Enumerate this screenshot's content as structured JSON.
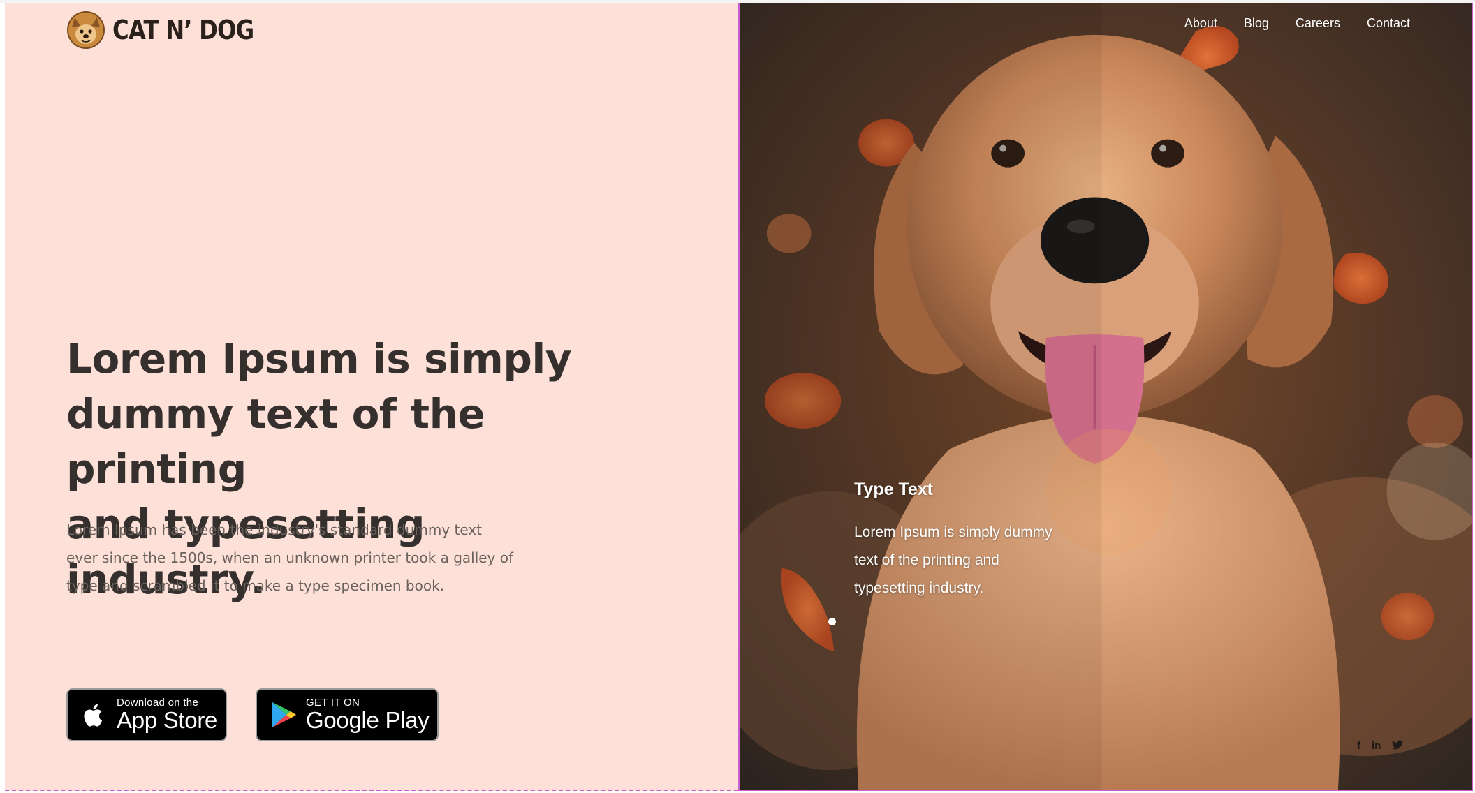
{
  "brand": {
    "name": "CAT N’ DOG",
    "logo_icon": "cat-dog-logo-icon"
  },
  "hero": {
    "headline_lines": [
      "Lorem Ipsum is simply",
      "dummy text of the printing",
      "and typesetting industry."
    ],
    "body_lines": [
      "Lorem Ipsum has been the industry's standard dummy text",
      "ever since the 1500s, when an unknown printer took a galley of",
      "type and scrambled it to make a type specimen book."
    ]
  },
  "stores": {
    "apple": {
      "small": "Download on the",
      "big": "App Store",
      "icon": "apple-icon"
    },
    "google": {
      "small": "GET IT ON",
      "big": "Google Play",
      "icon": "google-play-icon"
    }
  },
  "nav": {
    "items": [
      "About",
      "Blog",
      "Careers",
      "Contact"
    ]
  },
  "slide": {
    "title": "Type Text",
    "body_lines": [
      "Lorem Ipsum is simply dummy",
      "text of the printing and",
      "typesetting industry."
    ]
  },
  "social": {
    "facebook": "f",
    "linkedin": "in",
    "twitter_icon": "twitter-icon"
  },
  "colors": {
    "left_bg": "#fde1d8",
    "heading": "#35302d",
    "body_text": "#6a615d",
    "outline_accent": "#c85fd1"
  }
}
